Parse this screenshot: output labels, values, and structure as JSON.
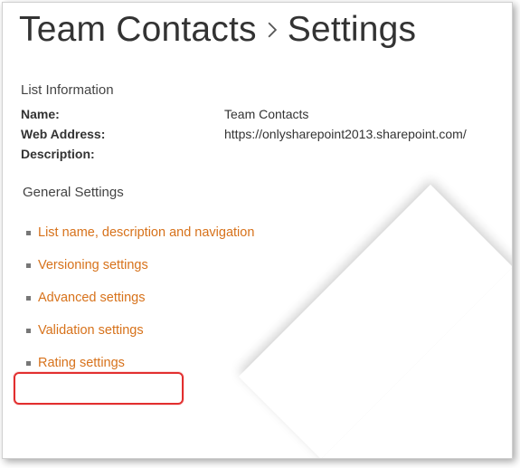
{
  "breadcrumb": {
    "parent": "Team Contacts",
    "current": "Settings"
  },
  "listInfo": {
    "heading": "List Information",
    "name_label": "Name:",
    "name_value": "Team Contacts",
    "web_label": "Web Address:",
    "web_value": "https://onlysharepoint2013.sharepoint.com/",
    "desc_label": "Description:",
    "desc_value": ""
  },
  "generalSettings": {
    "heading": "General Settings",
    "links": [
      {
        "label": "List name, description and navigation"
      },
      {
        "label": "Versioning settings"
      },
      {
        "label": "Advanced settings"
      },
      {
        "label": "Validation settings"
      },
      {
        "label": "Rating settings"
      }
    ]
  }
}
